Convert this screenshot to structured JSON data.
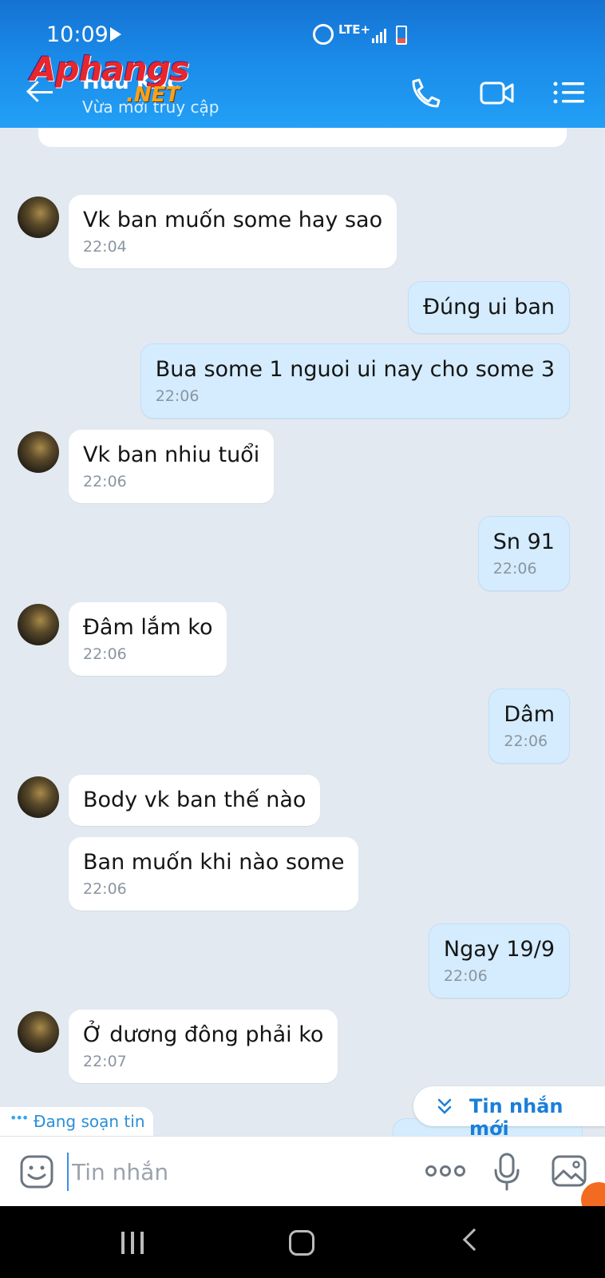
{
  "status_bar": {
    "time": "10:09",
    "network": "LTE+"
  },
  "header": {
    "contact_name": "Huu Khc",
    "contact_status": "Vừa mới truy cập"
  },
  "watermark": {
    "line1": "Aphangs",
    "line2": ".NET"
  },
  "messages": [
    {
      "dir": "in",
      "text": "Vk ban muốn some hay sao",
      "time": "22:04"
    },
    {
      "dir": "out",
      "text": "Đúng ui ban",
      "time": ""
    },
    {
      "dir": "out",
      "text": "Bua some 1 nguoi ui nay cho some 3",
      "time": "22:06"
    },
    {
      "dir": "in",
      "text": "Vk ban nhiu tuổi",
      "time": "22:06"
    },
    {
      "dir": "out",
      "text": "Sn 91",
      "time": "22:06"
    },
    {
      "dir": "in",
      "text": "Đâm lắm ko",
      "time": "22:06"
    },
    {
      "dir": "out",
      "text": "Dâm",
      "time": "22:06"
    },
    {
      "dir": "in",
      "text": "Body vk ban thế nào",
      "time": ""
    },
    {
      "dir": "in",
      "text": "Ban muốn khi nào some",
      "time": "22:06"
    },
    {
      "dir": "out",
      "text": "Ngay 19/9",
      "time": "22:06"
    },
    {
      "dir": "in",
      "text": "Ở dương đông phải ko",
      "time": "22:07"
    }
  ],
  "new_messages_label": "Tin nhắn mới",
  "typing_label": "Đang soạn tin",
  "composer": {
    "placeholder": "Tin nhắn",
    "value": ""
  }
}
